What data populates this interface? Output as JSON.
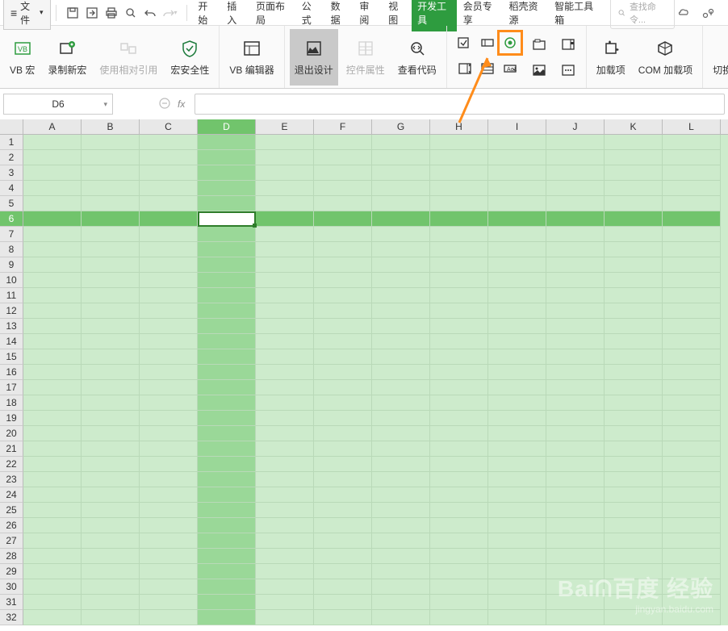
{
  "topbar": {
    "file_label": "文件",
    "search_placeholder": "查找命令...",
    "tabs": [
      "开始",
      "插入",
      "页面布局",
      "公式",
      "数据",
      "审阅",
      "视图",
      "开发工具",
      "会员专享",
      "稻壳资源",
      "智能工具箱"
    ],
    "active_tab_index": 7
  },
  "ribbon": {
    "vb_macro": "VB 宏",
    "record_macro": "录制新宏",
    "use_relative_ref": "使用相对引用",
    "macro_security": "宏安全性",
    "vb_editor": "VB 编辑器",
    "exit_design": "退出设计",
    "control_props": "控件属性",
    "view_code": "查看代码",
    "addins": "加载项",
    "com_addins": "COM 加载项",
    "switch_js": "切换到JS环境"
  },
  "formula_bar": {
    "name_box_value": "D6",
    "fx_label": "fx"
  },
  "sheet": {
    "columns": [
      "A",
      "B",
      "C",
      "D",
      "E",
      "F",
      "G",
      "H",
      "I",
      "J",
      "K",
      "L"
    ],
    "selected_col_index": 3,
    "rows": [
      "1",
      "2",
      "3",
      "4",
      "5",
      "6",
      "7",
      "8",
      "9",
      "10",
      "11",
      "12",
      "13",
      "14",
      "15",
      "16",
      "17",
      "18",
      "19",
      "20",
      "21",
      "22",
      "23",
      "24",
      "25",
      "26",
      "27",
      "28",
      "29",
      "30",
      "31",
      "32"
    ],
    "selected_row_index": 5
  },
  "watermark": {
    "brand": "Baiᕬ百度 经验",
    "url": "jingyan.baidu.com"
  }
}
